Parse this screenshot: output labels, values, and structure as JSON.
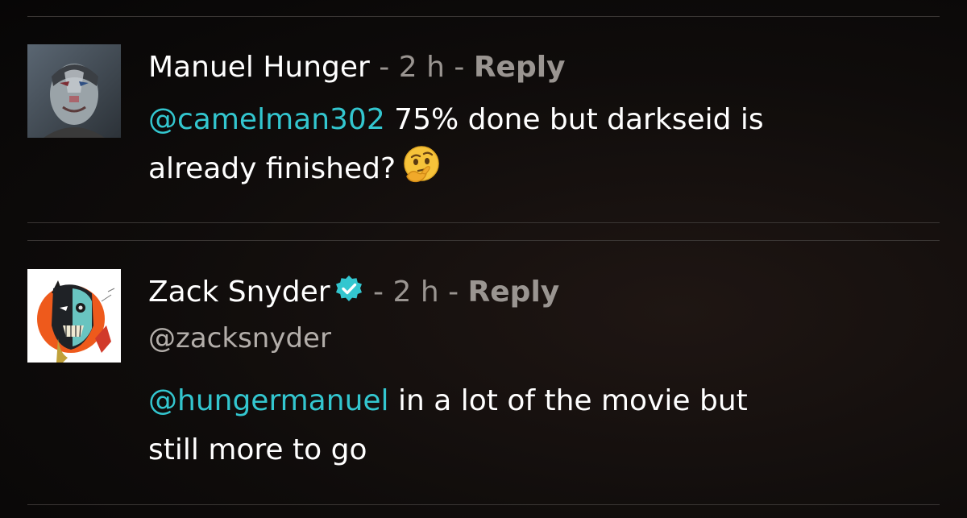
{
  "comments": [
    {
      "author": "Manuel Hunger",
      "separator": " - ",
      "time": "2 h",
      "reply_label": "Reply",
      "mention": "@camelman302",
      "text_line1": " 75% done but darkseid is",
      "text_line2": "already finished?",
      "emoji": "thinking-face-icon"
    },
    {
      "author": "Zack Snyder",
      "verified": true,
      "separator": " - ",
      "time": "2 h",
      "reply_label": "Reply",
      "handle": "@zacksnyder",
      "mention": "@hungermanuel",
      "text_line1": " in a lot of the movie but",
      "text_line2": "still more to go"
    }
  ],
  "colors": {
    "mention": "#33c6cf",
    "verified_badge": "#33c6cf",
    "meta_text": "#9a9591",
    "background": "#0f0c0b"
  }
}
